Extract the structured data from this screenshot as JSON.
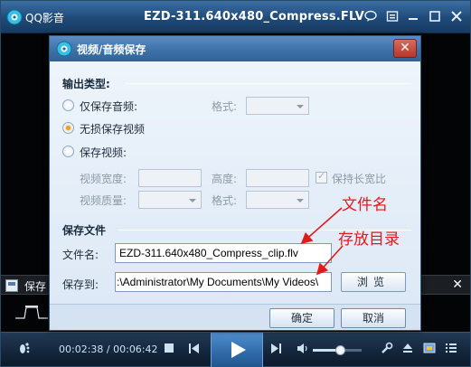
{
  "player": {
    "app_name": "QQ影音",
    "file_title": "EZD-311.640x480_Compress.FLV",
    "current_time": "00:02:38",
    "total_time": "00:06:42",
    "time_separator": " / ",
    "volume": 0.55,
    "save_strip_label": "保存",
    "icons": [
      "qq-player-logo-icon",
      "chat-icon",
      "skin-icon",
      "minimize-icon",
      "maximize-icon",
      "close-icon",
      "footprint-icon",
      "stop-icon",
      "previous-icon",
      "play-icon",
      "next-icon",
      "volume-icon",
      "tools-icon",
      "eject-icon",
      "screenshot-icon",
      "playlist-icon"
    ]
  },
  "dialog": {
    "title": "视频/音频保存",
    "output_section": "输出类型:",
    "radio_audio_only": "仅保存音频:",
    "radio_lossless": "无损保存视频",
    "radio_video": "保存视频:",
    "selected_option": "无损保存视频",
    "format_label": "格式:",
    "video_width_label": "视频宽度:",
    "height_label": "高度:",
    "keep_ratio_label": "保持长宽比",
    "video_quality_label": "视频质量:",
    "format_label_2": "格式:",
    "file_section": "保存文件",
    "filename_label": "文件名:",
    "filename_value": "EZD-311.640x480_Compress_clip.flv",
    "saveto_label": "保存到:",
    "saveto_value": ":\\Administrator\\My Documents\\My Videos\\",
    "browse_label": "浏览",
    "ok_label": "确定",
    "cancel_label": "取消"
  },
  "annotations": {
    "filename_note": "文件名",
    "folder_note": "存放目录",
    "color": "#e11a1a"
  },
  "colors": {
    "titlebar": "#1f4a78",
    "dialog_bg": "#d4e2f1",
    "accent_radio": "#f0a020"
  }
}
